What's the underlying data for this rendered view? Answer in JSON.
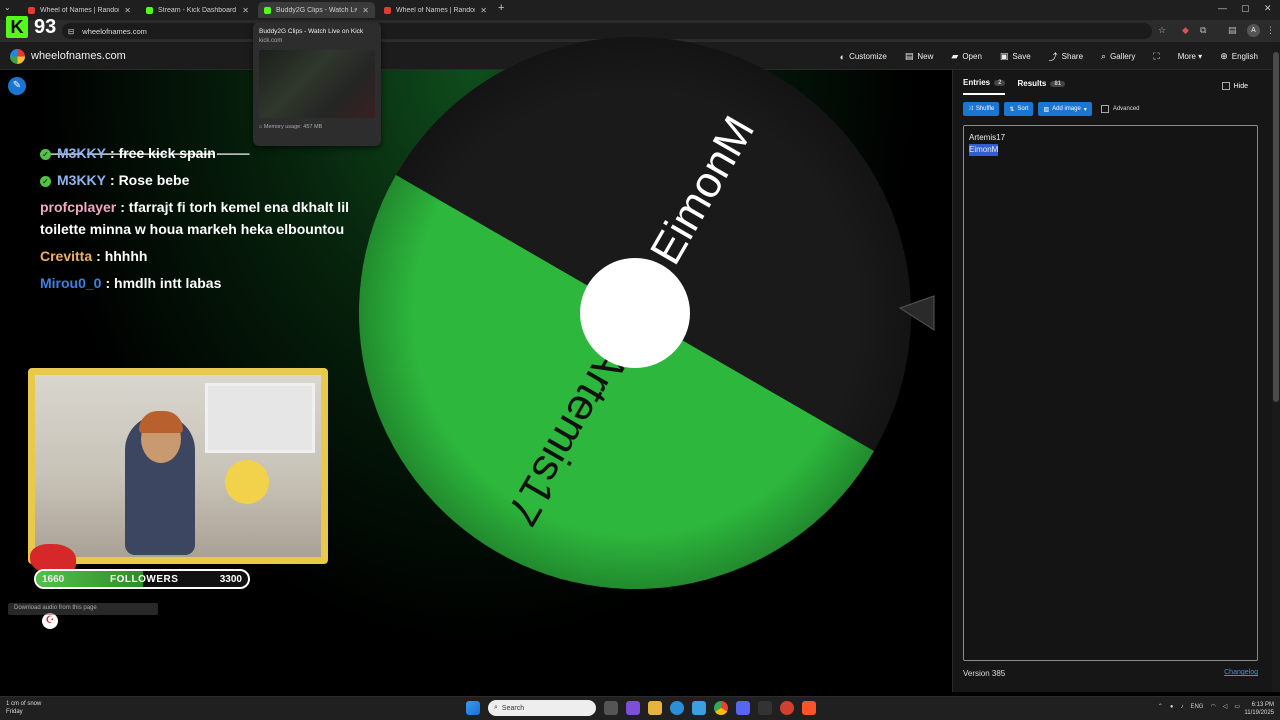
{
  "browser": {
    "tabs": [
      {
        "label": "Wheel of Names | Random name picker",
        "favicon_color": "#e53935"
      },
      {
        "label": "Stream - Kick Dashboard",
        "favicon_color": "#53fc18"
      },
      {
        "label": "Buddy2G Clips - Watch Live on Kick",
        "favicon_color": "#53fc18"
      },
      {
        "label": "Wheel of Names | Random name picker",
        "favicon_color": "#e53935"
      }
    ],
    "url": "wheelofnames.com",
    "preview": {
      "title": "Buddy2G Clips - Watch Live on Kick",
      "domain": "kick.com",
      "memory": "Memory usage: 457 MB"
    }
  },
  "overlay": {
    "viewer_count": "93",
    "logo": "K"
  },
  "app": {
    "title": "wheelofnames.com",
    "menu": [
      {
        "icon": "palette-icon",
        "glyph": "◐",
        "label": "Customize"
      },
      {
        "icon": "new-file-icon",
        "glyph": "▤",
        "label": "New"
      },
      {
        "icon": "folder-icon",
        "glyph": "▰",
        "label": "Open"
      },
      {
        "icon": "save-icon",
        "glyph": "▣",
        "label": "Save"
      },
      {
        "icon": "share-icon",
        "glyph": "⤴",
        "label": "Share"
      },
      {
        "icon": "search-icon",
        "glyph": "⌕",
        "label": "Gallery"
      },
      {
        "icon": "fullscreen-icon",
        "glyph": "⛶",
        "label": ""
      },
      {
        "icon": "more-icon",
        "glyph": "",
        "label": "More ▾"
      },
      {
        "icon": "globe-icon",
        "glyph": "⊕",
        "label": "English"
      }
    ]
  },
  "wheel": {
    "segments": [
      {
        "label": "EimonM",
        "color": "#1a1a1a"
      },
      {
        "label": "Artemis17",
        "color": "#2db83d"
      }
    ],
    "hub_color": "#ffffff"
  },
  "chat": {
    "messages": [
      {
        "user": "M3KKY",
        "user_color": "#8fb3f0",
        "badge": true,
        "text": ": free kick spain"
      },
      {
        "user": "M3KKY",
        "user_color": "#8fb3f0",
        "badge": true,
        "text": ": Rose bebe"
      },
      {
        "user": "profcplayer",
        "user_color": "#f0a8c8",
        "badge": false,
        "text": ": tfarrajt fi torh kemel ena dkhalt lil toilette minna w houa markeh heka elbountou"
      },
      {
        "user": "Crevitta",
        "user_color": "#f0b060",
        "badge": false,
        "text": ": hhhhh"
      },
      {
        "user": "Mirou0_0",
        "user_color": "#3f7fe0",
        "badge": false,
        "text": ": hmdlh intt labas"
      }
    ]
  },
  "followers": {
    "current": "1660",
    "label": "FOLLOWERS",
    "goal": "3300",
    "progress": 0.503
  },
  "download_audio": "Download audio from this page",
  "panel": {
    "tabs": [
      {
        "label": "Entries",
        "count": "2"
      },
      {
        "label": "Results",
        "count": "81"
      }
    ],
    "hide_label": "Hide",
    "buttons": {
      "shuffle": "Shuffle",
      "sort": "Sort",
      "add_image": "Add image",
      "advanced": "Advanced"
    },
    "entries": [
      "Artemis17",
      "EimonM"
    ],
    "version": "Version 385",
    "changelog": "Changelog"
  },
  "taskbar": {
    "weather_line1": "1 cm of snow",
    "weather_line2": "Friday",
    "search_placeholder": "Search",
    "language": "ENG",
    "time": "6:13 PM",
    "date": "11/19/2025"
  }
}
